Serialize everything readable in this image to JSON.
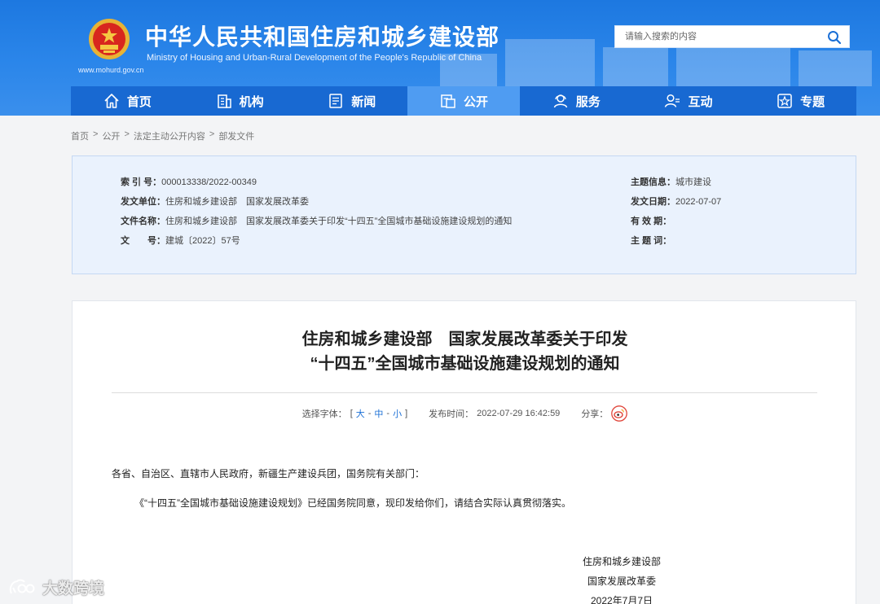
{
  "header": {
    "title_cn": "中华人民共和国住房和城乡建设部",
    "title_en": "Ministry of Housing and Urban-Rural Development of the People's Republic of China",
    "site_url": "www.mohurd.gov.cn",
    "emblem_icon": "national-emblem-icon",
    "search_placeholder": "请输入搜索的内容",
    "search_icon": "search-icon"
  },
  "nav": {
    "items": [
      {
        "label": "首页",
        "icon": "home-icon"
      },
      {
        "label": "机构",
        "icon": "building-icon"
      },
      {
        "label": "新闻",
        "icon": "news-document-icon"
      },
      {
        "label": "公开",
        "icon": "disclosure-icon"
      },
      {
        "label": "服务",
        "icon": "service-user-icon"
      },
      {
        "label": "互动",
        "icon": "interaction-user-icon"
      },
      {
        "label": "专题",
        "icon": "star-badge-icon"
      }
    ],
    "active": "公开"
  },
  "breadcrumb": {
    "items": [
      "首页",
      "公开",
      "法定主动公开内容",
      "部发文件"
    ],
    "separator": ">"
  },
  "meta": {
    "left": [
      {
        "label": "索 引 号：",
        "value": "000013338/2022-00349"
      },
      {
        "label": "发文单位：",
        "value": "住房和城乡建设部　国家发展改革委"
      },
      {
        "label": "文件名称：",
        "value": "住房和城乡建设部　国家发展改革委关于印发“十四五”全国城市基础设施建设规划的通知"
      },
      {
        "label": "文　　号：",
        "value": "建城〔2022〕57号"
      }
    ],
    "right": [
      {
        "label": "主题信息：",
        "value": "城市建设"
      },
      {
        "label": "发文日期：",
        "value": "2022-07-07"
      },
      {
        "label": "有 效 期：",
        "value": ""
      },
      {
        "label": "主 题 词：",
        "value": ""
      }
    ]
  },
  "article": {
    "title_line1": "住房和城乡建设部　国家发展改革委关于印发",
    "title_line2": "“十四五”全国城市基础设施建设规划的通知",
    "font_label": "选择字体：",
    "font_open": "[ ",
    "font_large": "大",
    "font_medium": "中",
    "font_small": "小",
    "font_sep": " - ",
    "font_close": " ]",
    "publish_label": "发布时间：",
    "publish_time": "2022-07-29 16:42:59",
    "share_label": "分享：",
    "share_icon": "weibo-icon",
    "salutation": "各省、自治区、直辖市人民政府，新疆生产建设兵团，国务院有关部门：",
    "paragraph": "《“十四五”全国城市基础设施建设规划》已经国务院同意，现印发给你们，请结合实际认真贯彻落实。",
    "signature": [
      "住房和城乡建设部",
      "国家发展改革委",
      "2022年7月7日"
    ]
  },
  "watermark": {
    "text": "大数跨境",
    "icon": "watermark-logo-icon"
  },
  "colors": {
    "header_blue": "#2b86ea",
    "nav_blue": "#1869d2",
    "nav_active": "#4f9cf2",
    "panel_bg": "#eaf2fd",
    "link_blue": "#1a6fd6"
  }
}
